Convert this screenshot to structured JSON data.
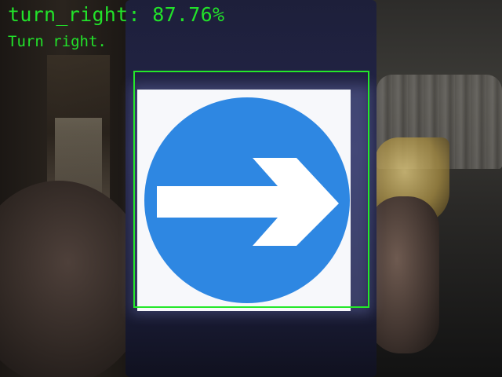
{
  "detection": {
    "headline": "turn_right: 87.76%",
    "description": "Turn right.",
    "box_color": "#24e82a",
    "label_color": "#22e22a"
  },
  "sign": {
    "icon": "turn-right-arrow-icon",
    "circle_color": "#2e87e2",
    "arrow_color": "#ffffff"
  }
}
